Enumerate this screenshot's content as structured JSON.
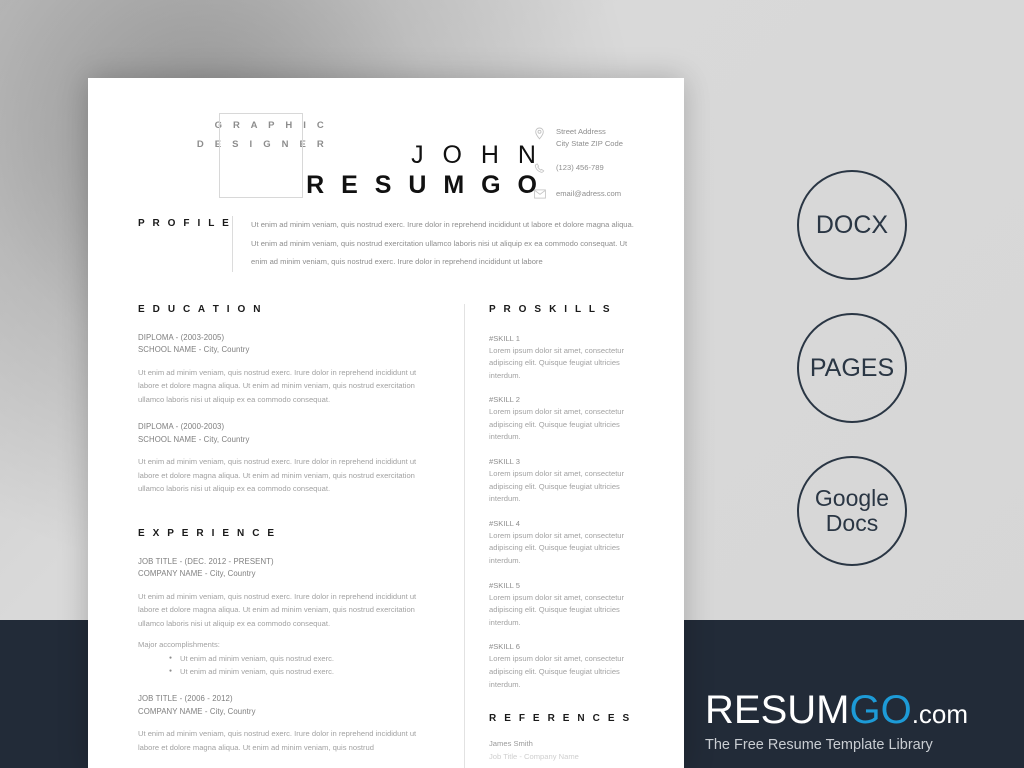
{
  "resume": {
    "job_title_line1": "G R A P H I C",
    "job_title_line2": "D E S I G N E R",
    "first_name": "J O H N",
    "last_name": "R E S U M G O",
    "contact": [
      {
        "icon": "location-pin-icon",
        "line1": "Street Address",
        "line2": "City State ZIP Code"
      },
      {
        "icon": "phone-icon",
        "line1": "(123) 456-789",
        "line2": ""
      },
      {
        "icon": "envelope-icon",
        "line1": "email@adress.com",
        "line2": ""
      }
    ],
    "profile": {
      "label": "P R O F I L E",
      "text": "Ut enim ad minim veniam, quis nostrud exerc. Irure dolor in reprehend incididunt ut labore et dolore magna aliqua. Ut enim ad minim veniam, quis nostrud exercitation ullamco laboris nisi ut aliquip ex ea commodo consequat. Ut enim ad minim veniam, quis nostrud exerc. Irure dolor in reprehend incididunt ut labore"
    },
    "education": {
      "heading": "E D U C A T I O N",
      "entries": [
        {
          "title": "DIPLOMA - (2003-2005)",
          "sub": "SCHOOL NAME - City, Country",
          "body": "Ut enim ad minim veniam, quis nostrud exerc. Irure dolor in reprehend incididunt ut labore et dolore magna aliqua. Ut enim ad minim veniam, quis nostrud exercitation ullamco laboris nisi ut aliquip ex ea commodo consequat."
        },
        {
          "title": "DIPLOMA - (2000-2003)",
          "sub": "SCHOOL NAME - City, Country",
          "body": "Ut enim ad minim veniam, quis nostrud exerc. Irure dolor in reprehend incididunt ut labore et dolore magna aliqua. Ut enim ad minim veniam, quis nostrud exercitation ullamco laboris nisi ut aliquip ex ea commodo consequat."
        }
      ]
    },
    "experience": {
      "heading": "E X P E R I E N C E",
      "entries": [
        {
          "title": "JOB TITLE - (DEC. 2012 - PRESENT)",
          "sub": "COMPANY NAME - City, Country",
          "body": "Ut enim ad minim veniam, quis nostrud exerc. Irure dolor in reprehend incididunt ut labore et dolore magna aliqua. Ut enim ad minim veniam, quis nostrud exercitation ullamco laboris nisi ut aliquip ex ea commodo consequat.",
          "accomplishments_label": "Major accomplishments:",
          "accomplishments": [
            "Ut enim ad minim veniam, quis nostrud exerc.",
            "Ut enim ad minim veniam, quis nostrud exerc."
          ]
        },
        {
          "title": "JOB TITLE - (2006 - 2012)",
          "sub": "COMPANY NAME - City, Country",
          "body": "Ut enim ad minim veniam, quis nostrud exerc. Irure dolor in reprehend incididunt ut labore et dolore magna aliqua. Ut enim ad minim veniam, quis nostrud",
          "accomplishments_label": "",
          "accomplishments": []
        }
      ]
    },
    "skills": {
      "heading": "P R O  S K I L L S",
      "items": [
        {
          "name": "#SKILL 1",
          "desc": "Lorem ipsum dolor sit amet, consectetur adipiscing elit. Quisque feugiat ultricies interdum."
        },
        {
          "name": "#SKILL 2",
          "desc": "Lorem ipsum dolor sit amet, consectetur adipiscing elit. Quisque feugiat ultricies interdum."
        },
        {
          "name": "#SKILL 3",
          "desc": "Lorem ipsum dolor sit amet, consectetur adipiscing elit. Quisque feugiat ultricies interdum."
        },
        {
          "name": "#SKILL 4",
          "desc": "Lorem ipsum dolor sit amet, consectetur adipiscing elit. Quisque feugiat ultricies interdum."
        },
        {
          "name": "#SKILL 5",
          "desc": "Lorem ipsum dolor sit amet, consectetur adipiscing elit. Quisque feugiat ultricies interdum."
        },
        {
          "name": "#SKILL 6",
          "desc": "Lorem ipsum dolor sit amet, consectetur adipiscing elit. Quisque feugiat ultricies interdum."
        }
      ]
    },
    "references": {
      "heading": "R E F E R E N C E S",
      "items": [
        {
          "name": "James Smith",
          "sub": "Job Title - Company Name"
        }
      ]
    }
  },
  "badges": [
    {
      "label": "DOCX"
    },
    {
      "label": "PAGES"
    },
    {
      "label": "Google Docs"
    }
  ],
  "branding": {
    "logo_part1": "RESUM",
    "logo_part2": "GO",
    "logo_part3": ".com",
    "tagline": "The Free Resume Template Library"
  },
  "colors": {
    "footer_band": "#222b38",
    "badge_outline": "#2a3644",
    "logo_accent": "#1d9bd7"
  }
}
